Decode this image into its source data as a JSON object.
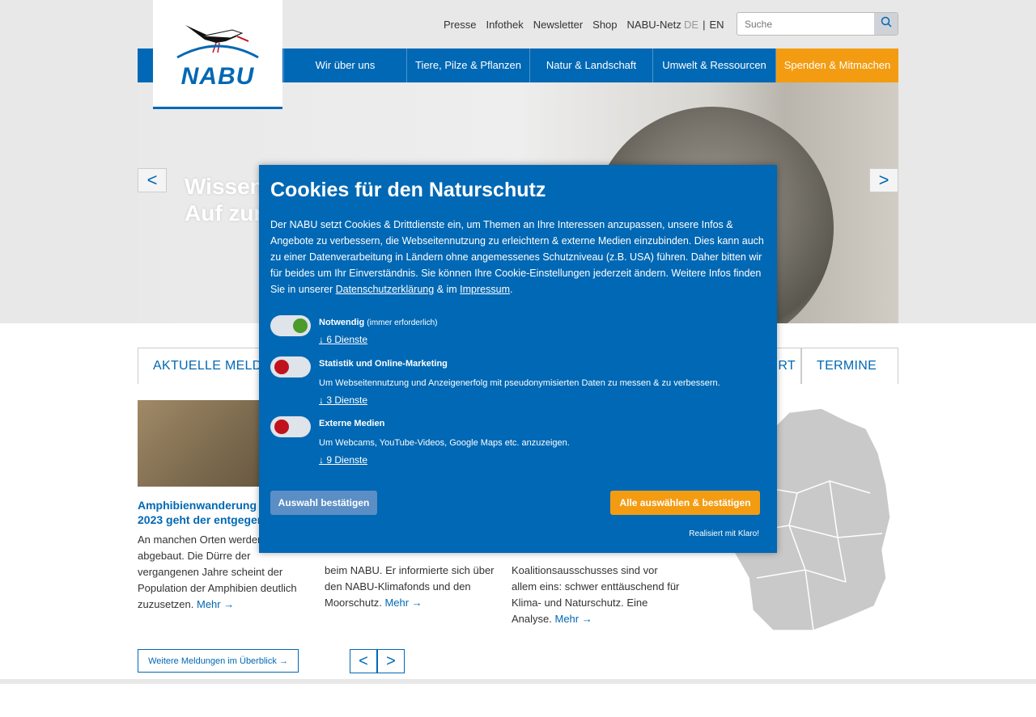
{
  "meta_nav": [
    "Presse",
    "Infothek",
    "Newsletter",
    "Shop",
    "NABU-Netz"
  ],
  "lang": {
    "de": "DE",
    "sep": "|",
    "en": "EN"
  },
  "search": {
    "placeholder": "Suche"
  },
  "logo": {
    "text": "NABU"
  },
  "main_nav": [
    {
      "label": "Wir über uns",
      "highlight": false
    },
    {
      "label": "Tiere, Pilze & Pflanzen",
      "highlight": false
    },
    {
      "label": "Natur & Landschaft",
      "highlight": false
    },
    {
      "label": "Umwelt & Ressourcen",
      "highlight": false
    },
    {
      "label": "Spenden & Mitmachen",
      "highlight": true
    }
  ],
  "hero": {
    "line1": "Wissen",
    "line2": "Auf zur",
    "prev": "<",
    "next": ">"
  },
  "tabs": {
    "news": "AKTUELLE MELDU",
    "local": "RT",
    "events": "TERMINE"
  },
  "news": [
    {
      "title": "Amphibienwanderung Frühjahr 2023 geht der entgegen",
      "text": "An manchen Orten werden Zäune abgebaut. Die Dürre der vergangenen Jahre scheint der Population der Amphibien deutlich zuzusetzen.",
      "more": "Mehr →"
    },
    {
      "title": "",
      "text": "beim NABU. Er informierte sich über den NABU-Klimafonds und den Moorschutz.",
      "more": "Mehr →"
    },
    {
      "title": "",
      "text": "Koalitionsausschusses sind vor allem eins: schwer enttäuschend für Klima- und Naturschutz. Eine Analyse.",
      "more": "Mehr →"
    }
  ],
  "more_news_button": "Weitere Meldungen im Überblick →",
  "pager": {
    "prev": "<",
    "next": ">"
  },
  "modal": {
    "title": "Cookies für den Naturschutz",
    "intro": "Der NABU setzt Cookies & Drittdienste ein, um Themen an Ihre Interessen anzupassen, unsere Infos & Angebote zu verbessern, die Webseitennutzung zu erleichtern & externe Medien einzubinden. Dies kann auch zu einer Datenverarbeitung in Ländern ohne angemessenes Schutzniveau (z.B. USA) führen. Daher bitten wir für beides um Ihr Einverständnis. Sie können Ihre Cookie-Einstellungen jederzeit ändern. Weitere Infos finden Sie in unserer ",
    "privacy_link": "Datenschutzerklärung",
    "and_in": " & im ",
    "imprint_link": "Impressum",
    "period": ".",
    "purposes": [
      {
        "title": "Notwendig",
        "note": "(immer erforderlich)",
        "desc": "",
        "link": "↓ 6 Dienste",
        "enabled": true
      },
      {
        "title": "Statistik und Online-Marketing",
        "note": "",
        "desc": "Um Webseitennutzung und Anzeigenerfolg mit pseudonymisierten Daten zu messen & zu verbessern.",
        "link": "↓ 3 Dienste",
        "enabled": false
      },
      {
        "title": "Externe Medien",
        "note": "",
        "desc": "Um Webcams, YouTube-Videos, Google Maps etc. anzuzeigen.",
        "link": "↓ 9 Dienste",
        "enabled": false
      }
    ],
    "confirm_selection": "Auswahl bestätigen",
    "accept_all": "Alle auswählen & bestätigen",
    "powered_by": "Realisiert mit Klaro!"
  },
  "colors": {
    "primary": "#0068b4",
    "accent": "#f39c12",
    "toggle_on": "#4a9a2c",
    "toggle_off": "#c0121c"
  }
}
